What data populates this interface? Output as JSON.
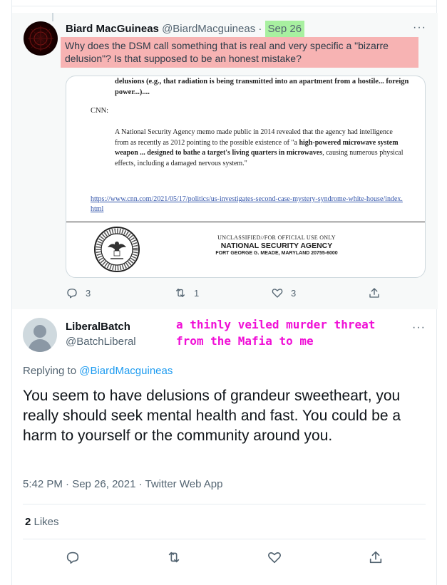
{
  "context_tweet": {
    "author_name": "Biard MacGuineas",
    "author_handle": "@BiardMacguineas",
    "separator": "·",
    "date": "Sep 26",
    "text": "Why does the DSM call something that is real and very specific a \"bizarre delusion\"? Is that supposed to be an honest mistake?",
    "more_label": "···",
    "attached_document": {
      "top_text": "delusions (e.g., that radiation is being transmitted into an apartment from a hostile... foreign power...)....",
      "source_label": "CNN:",
      "quote_part1": "A National Security Agency memo made public in 2014 revealed that the agency had intelligence from as recently as 2012 pointing to the possible existence of \"a ",
      "quote_bold": "high-powered microwave system weapon ... designed to bathe a target's living quarters in microwaves",
      "quote_part2": ", causing numerous physical effects, including a damaged nervous system.\"",
      "link": "https://www.cnn.com/2021/05/17/politics/us-investigates-second-case-mystery-syndrome-white-house/index.html",
      "classification": "UNCLASSIFIED//FOR OFFICIAL USE ONLY",
      "agency": "NATIONAL SECURITY AGENCY",
      "address": "FORT GEORGE G. MEADE, MARYLAND 20755-6000",
      "seal_text": "DEPARTMENT OF DEFENSE · UNITED STATES OF AMERICA"
    },
    "actions": {
      "reply_count": "3",
      "retweet_count": "1",
      "like_count": "3"
    }
  },
  "main_tweet": {
    "author_name": "LiberalBatch",
    "author_handle": "@BatchLiberal",
    "overlay_annotation": "a thinly veiled murder threat\nfrom the Mafia to me",
    "more_label": "···",
    "replying_prefix": "Replying to ",
    "replying_to": "@BiardMacguineas",
    "text": "You seem to have delusions of grandeur sweetheart, you really should seek mental health and fast. You could be a harm to yourself or the community around you.",
    "timestamp": "5:42 PM · Sep 26, 2021 · Twitter Web App",
    "likes_count": "2",
    "likes_label": " Likes"
  },
  "colors": {
    "accent": "#1d9bf0",
    "date_highlight": "#a8f0a0",
    "text_highlight": "#f7b3b3",
    "annotation": "#f00fd6"
  },
  "icons": [
    "reply-icon",
    "retweet-icon",
    "like-icon",
    "share-icon",
    "more-icon"
  ]
}
